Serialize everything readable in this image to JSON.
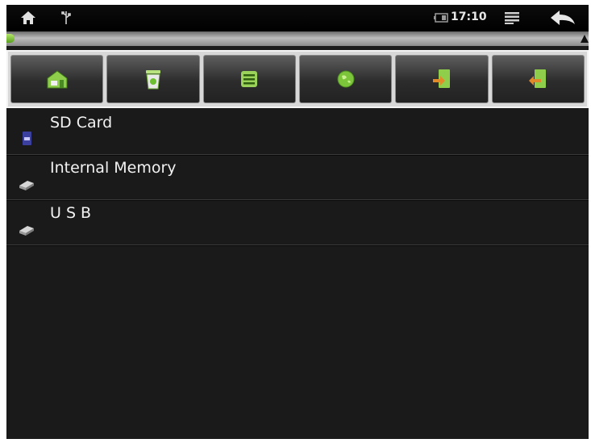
{
  "statusbar": {
    "time": "17:10",
    "icons": [
      "home-icon",
      "usb-icon",
      "battery-icon",
      "menu-icon",
      "back-icon"
    ]
  },
  "progress": {
    "fraction": 0.01,
    "color": "#7cc43a"
  },
  "toolbar": {
    "buttons": [
      {
        "icon": "home-folder-icon"
      },
      {
        "icon": "recycle-bin-icon"
      },
      {
        "icon": "list-view-icon"
      },
      {
        "icon": "globe-icon"
      },
      {
        "icon": "import-arrow-icon"
      },
      {
        "icon": "export-arrow-icon"
      }
    ]
  },
  "storage": {
    "items": [
      {
        "label": "SD Card",
        "icon": "sd-card-icon"
      },
      {
        "label": "Internal Memory",
        "icon": "drive-icon"
      },
      {
        "label": "U S B",
        "icon": "drive-icon"
      }
    ]
  },
  "colors": {
    "background": "#1a1a1a",
    "accent_green": "#6cbf2e",
    "text": "#f2f2f2"
  }
}
